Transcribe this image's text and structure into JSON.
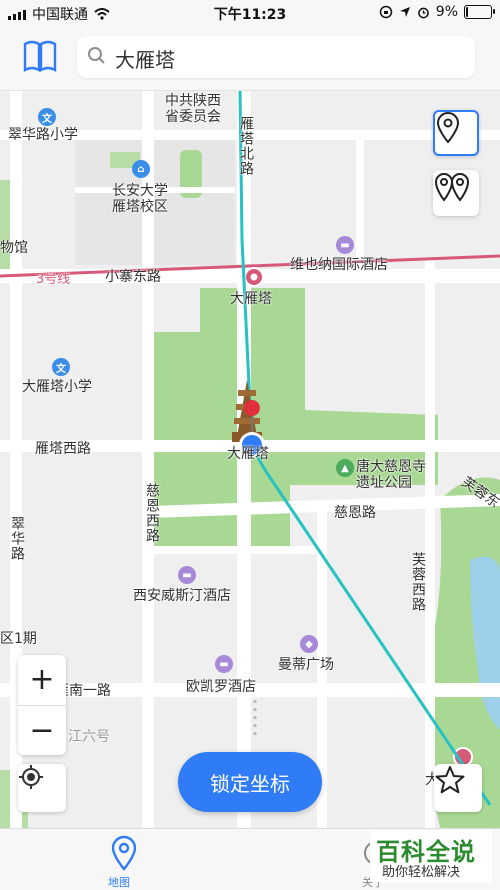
{
  "status_bar": {
    "carrier": "中国联通",
    "time": "下午11:23",
    "battery": "9%",
    "battery_level": 0.09
  },
  "search": {
    "value": "大雁塔",
    "placeholder": "大雁塔"
  },
  "map": {
    "labels": {
      "cuihua_school_n": "翠华路小学",
      "provincial_committee_1": "中共陕西",
      "provincial_committee_2": "省委员会",
      "yanta_north": "雁塔北路",
      "changan_uni_1": "长安大学",
      "changan_uni_2": "雁塔校区",
      "museum": "物馆",
      "line3": "3号线",
      "xiaozhai_east": "小寨东路",
      "venice_hotel": "维也纳国际酒店",
      "big_goose_station": "大雁塔",
      "big_goose_school": "大雁塔小学",
      "yanta_west": "雁塔西路",
      "pagoda": "大雁塔",
      "tang_park_1": "唐大慈恩寺",
      "tang_park_2": "遗址公园",
      "furong_east": "芙蓉东",
      "cien_road": "慈恩路",
      "cien_west": "慈恩西路",
      "cuihua_road": "翠华路",
      "furong_west": "芙蓉西路",
      "westin": "西安威斯汀酒店",
      "district": "区1期",
      "manhattan": "曼蒂广场",
      "yanan_1": "雁南一路",
      "okura": "欧凯罗酒店",
      "jiang6": "江六号",
      "big_goose_station_2": "大"
    }
  },
  "controls": {
    "zoom_in": "+",
    "zoom_out": "−",
    "lock_button": "锁定坐标"
  },
  "tabbar": {
    "map": "地图",
    "about": "关于"
  },
  "watermark": {
    "title": "百科全说",
    "subtitle": "助你轻松解决"
  },
  "colors": {
    "accent": "#2f7cf6",
    "park": "#a9d894",
    "route": "#26c2c2",
    "metro": "#d65a78"
  }
}
